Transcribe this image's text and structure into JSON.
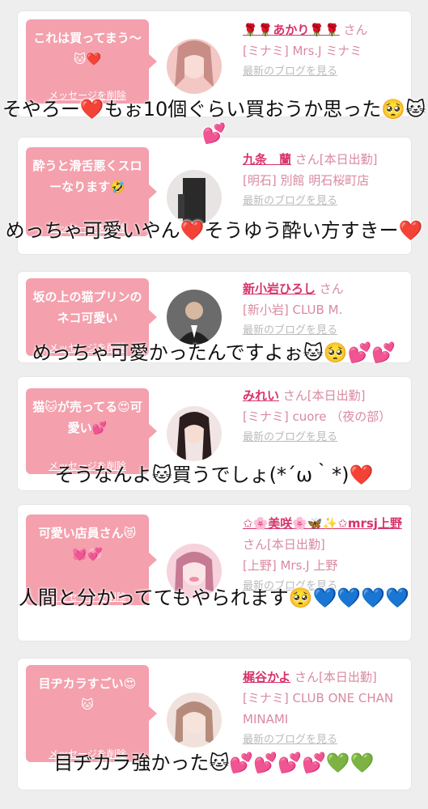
{
  "cards": [
    {
      "message": "これは買ってまう〜🐱❤️",
      "delete_label": "メッセージを削除",
      "name": "🌹🌹あかり🌹🌹",
      "honorific": "さん",
      "store": "[ミナミ] Mrs.J ミナミ",
      "blog_link": "最新のブログを見る",
      "avatar_colors": [
        "#f3c7c4",
        "#c98d88"
      ]
    },
    {
      "message": "酔うと滑舌悪くスローなります🤣",
      "delete_label": "メッセージを削除",
      "name": "九条　蘭",
      "honorific": "さん[本日出勤]",
      "store": "[明石] 別館 明石桜町店",
      "blog_link": "最新のブログを見る",
      "avatar_colors": [
        "#e8e4e4",
        "#2a2a2a"
      ]
    },
    {
      "message": "坂の上の猫プリンのネコ可愛い",
      "delete_label": "メッセージを削除",
      "name": "新小岩ひろし",
      "honorific": "さん",
      "store": "[新小岩] CLUB M.",
      "blog_link": "最新のブログを見る",
      "avatar_colors": [
        "#6b6b6b",
        "#1f1f1f"
      ]
    },
    {
      "message": "猫🐱が売ってる😍可愛い💕",
      "delete_label": "メッセージを削除",
      "name": "みれい",
      "honorific": "さん[本日出勤]",
      "store": "[ミナミ] cuore （夜の部）",
      "blog_link": "最新のブログを見る",
      "avatar_colors": [
        "#f1e4e4",
        "#2b1d1d"
      ]
    },
    {
      "message": "可愛い店員さん😻💓💞",
      "delete_label": "メッセージを削除",
      "name": "✩🌸美咲🌸🦋✨✩mrsj上野",
      "honorific": "さん[本日出勤]",
      "store": "[上野] Mrs.J 上野",
      "blog_link": "最新のブログを見る",
      "avatar_colors": [
        "#f6d2dc",
        "#c77a93"
      ]
    },
    {
      "message": "目ヂカラすごい😍🐱",
      "delete_label": "メッセージを削除",
      "name": "梶谷かよ",
      "honorific": "さん[本日出勤]",
      "store": "[ミナミ] CLUB ONE CHAN MINAMI",
      "blog_link": "最新のブログを見る",
      "avatar_colors": [
        "#f1e1dc",
        "#b58c7c"
      ]
    }
  ],
  "overlays": [
    "そやろー❤️もぉ10個ぐらい買おうか思った🥺🐱💕",
    "めっちゃ可愛いやん❤️そうゆう酔い方すきー❤️",
    "めっちゃ可愛かったんですよぉ🐱🥺💕💕",
    "そうなんよ🐱買うでしょ(*´ω｀*)❤️",
    "人間と分かっててもやられます🥺💙💙💙💙",
    "目ヂカラ強かった🐱💕💕💕💕💚💚"
  ]
}
